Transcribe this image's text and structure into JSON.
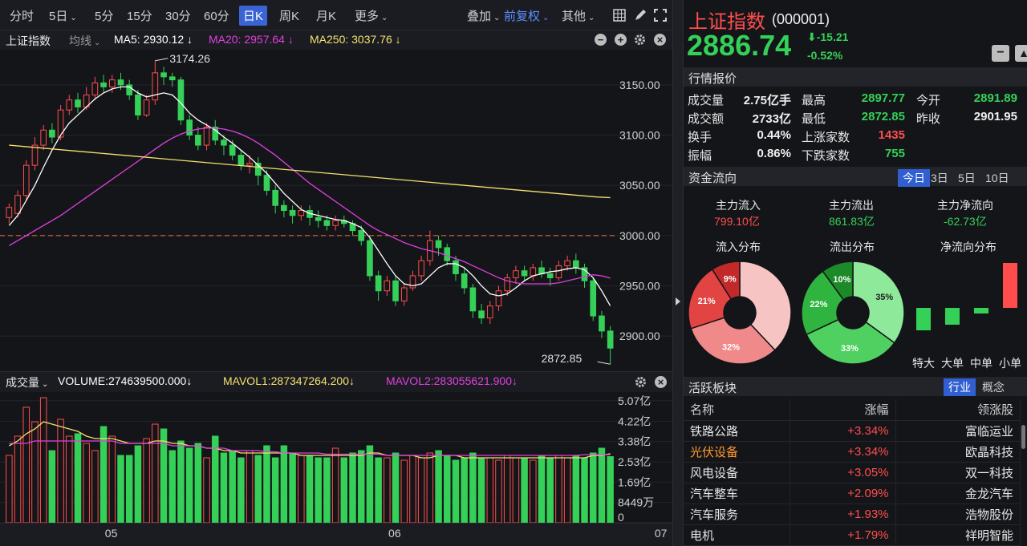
{
  "toolbar": {
    "periods": [
      "分时",
      "5日",
      "5分",
      "15分",
      "30分",
      "60分",
      "日K",
      "周K",
      "月K",
      "更多"
    ],
    "active_period": "日K",
    "overlay": "叠加",
    "adjust": "前复权",
    "other": "其他"
  },
  "chart_head": {
    "index_name": "上证指数",
    "ma_label": "均线",
    "ma5": "MA5: 2930.12 ↓",
    "ma20": "MA20: 2957.64 ↓",
    "ma250": "MA250: 3037.76 ↓"
  },
  "vol_head": {
    "label": "成交量",
    "volume": "VOLUME:274639500.000↓",
    "mavol1": "MAVOL1:287347264.200↓",
    "mavol2": "MAVOL2:283055621.900↓"
  },
  "colors": {
    "up": "#ff4d4d",
    "down": "#34d058",
    "ma5": "#ffffff",
    "ma20": "#e040e0",
    "ma250": "#f5e06e",
    "accent": "#3a64d6"
  },
  "chart_data": {
    "type": "candlestick",
    "price_ylim": [
      2865,
      3185
    ],
    "price_ticks": [
      "3150.00",
      "3100.00",
      "3050.00",
      "3000.00",
      "2950.00",
      "2900.00"
    ],
    "price_tick_values": [
      3150,
      3100,
      3050,
      3000,
      2950,
      2900
    ],
    "reference_line": 3000,
    "high_annotation": "3174.26",
    "low_annotation": "2872.85",
    "x_labels": [
      "05",
      "06",
      "07"
    ],
    "x_label_index": [
      12,
      45,
      76
    ],
    "vol_ticks": [
      "5.07亿",
      "4.22亿",
      "3.38亿",
      "2.53亿",
      "1.69亿",
      "8449万",
      "0"
    ],
    "vol_tick_values": [
      5.07,
      4.22,
      3.38,
      2.53,
      1.69,
      0.8449,
      0
    ],
    "vol_max": 5.3,
    "candles": [
      [
        3018,
        3028,
        3032,
        3012
      ],
      [
        3022,
        3040,
        3045,
        3018
      ],
      [
        3040,
        3070,
        3075,
        3035
      ],
      [
        3070,
        3090,
        3098,
        3065
      ],
      [
        3090,
        3105,
        3110,
        3085
      ],
      [
        3105,
        3098,
        3112,
        3092
      ],
      [
        3098,
        3125,
        3130,
        3095
      ],
      [
        3125,
        3135,
        3140,
        3120
      ],
      [
        3135,
        3128,
        3142,
        3122
      ],
      [
        3128,
        3140,
        3148,
        3125
      ],
      [
        3140,
        3152,
        3158,
        3135
      ],
      [
        3152,
        3148,
        3160,
        3142
      ],
      [
        3148,
        3155,
        3160,
        3142
      ],
      [
        3155,
        3150,
        3162,
        3145
      ],
      [
        3150,
        3140,
        3155,
        3135
      ],
      [
        3140,
        3120,
        3145,
        3115
      ],
      [
        3120,
        3135,
        3140,
        3118
      ],
      [
        3135,
        3162,
        3174,
        3130
      ],
      [
        3162,
        3158,
        3168,
        3150
      ],
      [
        3158,
        3155,
        3162,
        3148
      ],
      [
        3155,
        3115,
        3158,
        3110
      ],
      [
        3115,
        3100,
        3120,
        3095
      ],
      [
        3100,
        3090,
        3108,
        3085
      ],
      [
        3090,
        3108,
        3112,
        3085
      ],
      [
        3108,
        3095,
        3115,
        3090
      ],
      [
        3095,
        3090,
        3100,
        3080
      ],
      [
        3090,
        3080,
        3095,
        3075
      ],
      [
        3080,
        3070,
        3085,
        3065
      ],
      [
        3070,
        3072,
        3080,
        3062
      ],
      [
        3072,
        3060,
        3078,
        3050
      ],
      [
        3060,
        3045,
        3065,
        3040
      ],
      [
        3045,
        3030,
        3050,
        3022
      ],
      [
        3030,
        3025,
        3035,
        3018
      ],
      [
        3025,
        3020,
        3030,
        3012
      ],
      [
        3020,
        3025,
        3030,
        3015
      ],
      [
        3025,
        3018,
        3030,
        3010
      ],
      [
        3018,
        3015,
        3025,
        3008
      ],
      [
        3015,
        3010,
        3020,
        3005
      ],
      [
        3010,
        3015,
        3020,
        3005
      ],
      [
        3015,
        3012,
        3020,
        3008
      ],
      [
        3012,
        3005,
        3015,
        3000
      ],
      [
        3005,
        2995,
        3010,
        2990
      ],
      [
        2995,
        2960,
        3000,
        2955
      ],
      [
        2960,
        2945,
        2965,
        2935
      ],
      [
        2945,
        2955,
        2960,
        2940
      ],
      [
        2955,
        2935,
        2960,
        2930
      ],
      [
        2935,
        2948,
        2952,
        2930
      ],
      [
        2948,
        2960,
        2965,
        2945
      ],
      [
        2960,
        2975,
        2980,
        2955
      ],
      [
        2975,
        2995,
        3005,
        2970
      ],
      [
        2995,
        2988,
        3000,
        2980
      ],
      [
        2988,
        2975,
        2992,
        2970
      ],
      [
        2975,
        2962,
        2980,
        2955
      ],
      [
        2962,
        2948,
        2968,
        2942
      ],
      [
        2948,
        2925,
        2952,
        2918
      ],
      [
        2925,
        2918,
        2932,
        2912
      ],
      [
        2918,
        2930,
        2935,
        2912
      ],
      [
        2930,
        2945,
        2950,
        2925
      ],
      [
        2945,
        2958,
        2962,
        2940
      ],
      [
        2958,
        2965,
        2970,
        2952
      ],
      [
        2965,
        2960,
        2970,
        2955
      ],
      [
        2960,
        2968,
        2972,
        2955
      ],
      [
        2968,
        2962,
        2975,
        2958
      ],
      [
        2962,
        2958,
        2968,
        2950
      ],
      [
        2958,
        2970,
        2975,
        2955
      ],
      [
        2970,
        2975,
        2980,
        2965
      ],
      [
        2975,
        2968,
        2982,
        2962
      ],
      [
        2968,
        2955,
        2972,
        2948
      ],
      [
        2955,
        2920,
        2958,
        2915
      ],
      [
        2920,
        2905,
        2925,
        2898
      ],
      [
        2905,
        2888,
        2910,
        2872
      ]
    ],
    "volumes": [
      2.8,
      3.6,
      4.8,
      4.2,
      5.2,
      3.0,
      4.3,
      3.6,
      3.7,
      3.3,
      3.0,
      4.0,
      3.6,
      2.8,
      2.8,
      3.2,
      3.5,
      4.1,
      3.9,
      3.0,
      3.4,
      3.1,
      3.3,
      2.7,
      3.6,
      2.9,
      3.0,
      2.7,
      3.0,
      2.8,
      3.2,
      2.7,
      3.2,
      2.9,
      2.8,
      2.8,
      2.7,
      2.7,
      3.1,
      2.7,
      2.9,
      3.0,
      3.2,
      2.7,
      2.7,
      2.9,
      2.6,
      2.8,
      2.7,
      2.9,
      3.0,
      2.8,
      2.6,
      2.7,
      2.9,
      2.7,
      2.7,
      2.6,
      2.8,
      2.7,
      2.7,
      2.6,
      2.8,
      2.7,
      2.8,
      2.7,
      2.8,
      2.7,
      2.9,
      3.1,
      2.75
    ],
    "ma5": [
      3010,
      3020,
      3035,
      3050,
      3068,
      3085,
      3100,
      3112,
      3120,
      3128,
      3136,
      3142,
      3146,
      3148,
      3148,
      3142,
      3138,
      3140,
      3142,
      3140,
      3132,
      3122,
      3115,
      3110,
      3105,
      3098,
      3092,
      3085,
      3078,
      3070,
      3062,
      3052,
      3042,
      3034,
      3026,
      3022,
      3020,
      3018,
      3016,
      3015,
      3012,
      3008,
      2998,
      2985,
      2972,
      2960,
      2952,
      2950,
      2952,
      2960,
      2968,
      2972,
      2972,
      2968,
      2960,
      2950,
      2942,
      2940,
      2942,
      2948,
      2955,
      2960,
      2962,
      2964,
      2965,
      2967,
      2968,
      2966,
      2958,
      2945,
      2930.12
    ],
    "ma20": [
      2990,
      2995,
      3000,
      3005,
      3010,
      3015,
      3020,
      3026,
      3032,
      3038,
      3044,
      3050,
      3056,
      3062,
      3068,
      3074,
      3080,
      3086,
      3092,
      3097,
      3101,
      3104,
      3106,
      3107,
      3107,
      3106,
      3104,
      3101,
      3097,
      3092,
      3086,
      3080,
      3073,
      3066,
      3059,
      3052,
      3046,
      3040,
      3034,
      3028,
      3022,
      3016,
      3010,
      3005,
      3001,
      2997,
      2993,
      2990,
      2987,
      2985,
      2983,
      2980,
      2977,
      2974,
      2970,
      2966,
      2962,
      2958,
      2955,
      2953,
      2952,
      2952,
      2952,
      2952,
      2953,
      2955,
      2957,
      2959,
      2961,
      2960,
      2957.64
    ],
    "ma250": [
      3090,
      3088.8,
      3087.6,
      3086.4,
      3085.2,
      3084,
      3082.8,
      3081.6,
      3080.4,
      3079.2,
      3078,
      3076.8,
      3075.6,
      3074.4,
      3073.2,
      3072,
      3070.8,
      3069.6,
      3068.4,
      3067.2,
      3066,
      3064.8,
      3063.6,
      3062.4,
      3061.2,
      3060,
      3058.8,
      3057.6,
      3056.4,
      3055.2,
      3054,
      3052.8,
      3051.6,
      3050.4,
      3049.2,
      3048,
      3046.8,
      3045.6,
      3044.4,
      3043.2,
      3042,
      3040.8,
      3039.6,
      3038.4,
      3037.76
    ],
    "mavol1": [
      3.2,
      3.4,
      3.7,
      3.9,
      4.2,
      4.1,
      4.0,
      3.9,
      3.8,
      3.6,
      3.5,
      3.5,
      3.5,
      3.4,
      3.3,
      3.3,
      3.3,
      3.4,
      3.4,
      3.3,
      3.3,
      3.2,
      3.2,
      3.1,
      3.1,
      3.0,
      3.0,
      2.9,
      2.9,
      2.9,
      2.9,
      2.9,
      2.9,
      2.9,
      2.8,
      2.8,
      2.8,
      2.8,
      2.8,
      2.8,
      2.8,
      2.8,
      2.9,
      2.9,
      2.8,
      2.8,
      2.8,
      2.8,
      2.7,
      2.7,
      2.8,
      2.8,
      2.8,
      2.7,
      2.7,
      2.7,
      2.7,
      2.7,
      2.7,
      2.7,
      2.7,
      2.7,
      2.7,
      2.7,
      2.7,
      2.7,
      2.7,
      2.7,
      2.8,
      2.8,
      2.87
    ],
    "mavol2": [
      3.3,
      3.3,
      3.3,
      3.4,
      3.4,
      3.4,
      3.4,
      3.4,
      3.4,
      3.4,
      3.4,
      3.4,
      3.4,
      3.3,
      3.3,
      3.3,
      3.3,
      3.3,
      3.3,
      3.2,
      3.2,
      3.2,
      3.2,
      3.1,
      3.1,
      3.1,
      3.0,
      3.0,
      3.0,
      3.0,
      2.95,
      2.95,
      2.9,
      2.9,
      2.9,
      2.9,
      2.9,
      2.85,
      2.85,
      2.85,
      2.85,
      2.85,
      2.85,
      2.85,
      2.8,
      2.8,
      2.8,
      2.8,
      2.8,
      2.8,
      2.8,
      2.8,
      2.8,
      2.8,
      2.8,
      2.8,
      2.8,
      2.8,
      2.8,
      2.8,
      2.8,
      2.8,
      2.8,
      2.8,
      2.8,
      2.8,
      2.8,
      2.83,
      2.83,
      2.83,
      2.83
    ]
  },
  "quote": {
    "name": "上证指数",
    "code": "(000001)",
    "price": "2886.74",
    "change": "-15.21",
    "change_pct": "-0.52%"
  },
  "market": {
    "title": "行情报价",
    "rows": [
      {
        "l1": "成交量",
        "v1": "2.75亿手",
        "l2": "最高",
        "v2": "2897.77",
        "l3": "今开",
        "v3": "2891.89"
      },
      {
        "l1": "成交额",
        "v1": "2733亿",
        "l2": "最低",
        "v2": "2872.85",
        "l3": "昨收",
        "v3": "2901.95"
      },
      {
        "l1": "换手",
        "v1": "0.44%",
        "l2": "上涨家数",
        "v2": "1435",
        "l3": "",
        "v3": ""
      },
      {
        "l1": "振幅",
        "v1": "0.86%",
        "l2": "下跌家数",
        "v2": "755",
        "l3": "",
        "v3": ""
      }
    ]
  },
  "flow": {
    "title": "资金流向",
    "tabs": [
      "今日",
      "3日",
      "5日",
      "10日"
    ],
    "inflow_label": "主力流入",
    "inflow": "799.10亿",
    "outflow_label": "主力流出",
    "outflow": "861.83亿",
    "net_label": "主力净流向",
    "net": "-62.73亿",
    "in_dist_title": "流入分布",
    "out_dist_title": "流出分布",
    "net_dist_title": "净流向分布",
    "in_dist": [
      9,
      21,
      32,
      38
    ],
    "out_dist": [
      10,
      22,
      33,
      35
    ],
    "in_labels": [
      "9%",
      "21%",
      "32%"
    ],
    "out_labels": [
      "10%",
      "22%",
      "33%",
      "35%"
    ],
    "net_bars": [
      -0.4,
      -0.3,
      -0.1,
      0.8
    ],
    "net_cats": [
      "特大",
      "大单",
      "中单",
      "小单"
    ]
  },
  "sectors": {
    "title": "活跃板块",
    "tabs": [
      "行业",
      "概念"
    ],
    "headers": [
      "名称",
      "涨幅",
      "领涨股"
    ],
    "rows": [
      {
        "name": "铁路公路",
        "chg": "+3.34%",
        "lead": "富临运业"
      },
      {
        "name": "光伏设备",
        "chg": "+3.34%",
        "lead": "欧晶科技"
      },
      {
        "name": "风电设备",
        "chg": "+3.05%",
        "lead": "双一科技"
      },
      {
        "name": "汽车整车",
        "chg": "+2.09%",
        "lead": "金龙汽车"
      },
      {
        "name": "汽车服务",
        "chg": "+1.93%",
        "lead": "浩物股份"
      },
      {
        "name": "电机",
        "chg": "+1.79%",
        "lead": "祥明智能"
      }
    ]
  }
}
